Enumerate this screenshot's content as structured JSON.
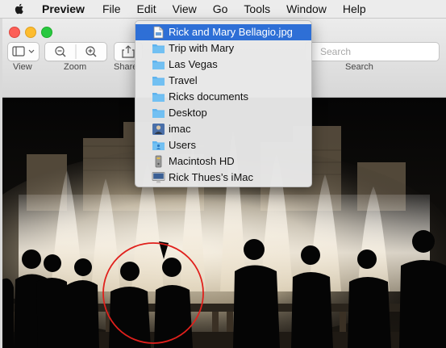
{
  "menubar": {
    "app_name": "Preview",
    "items": [
      "File",
      "Edit",
      "View",
      "Go",
      "Tools",
      "Window",
      "Help"
    ]
  },
  "toolbar": {
    "view_label": "View",
    "zoom_label": "Zoom",
    "share_label": "Share",
    "search_label": "Search",
    "search_placeholder": "Search"
  },
  "path_menu": {
    "items": [
      {
        "label": "Rick and Mary Bellagio.jpg",
        "icon": "jpg-file-icon",
        "selected": true
      },
      {
        "label": "Trip with Mary",
        "icon": "folder-icon"
      },
      {
        "label": "Las Vegas",
        "icon": "folder-icon"
      },
      {
        "label": "Travel",
        "icon": "folder-icon"
      },
      {
        "label": "Ricks documents",
        "icon": "folder-icon"
      },
      {
        "label": "Desktop",
        "icon": "folder-icon"
      },
      {
        "label": "imac",
        "icon": "user-home-icon"
      },
      {
        "label": "Users",
        "icon": "users-folder-icon"
      },
      {
        "label": "Macintosh HD",
        "icon": "hard-drive-icon"
      },
      {
        "label": "Rick Thues’s iMac",
        "icon": "imac-computer-icon"
      }
    ]
  },
  "colors": {
    "highlight": "#2e6fd6",
    "folder": "#5fb3ee",
    "annotation_circle": "#e0201c"
  }
}
